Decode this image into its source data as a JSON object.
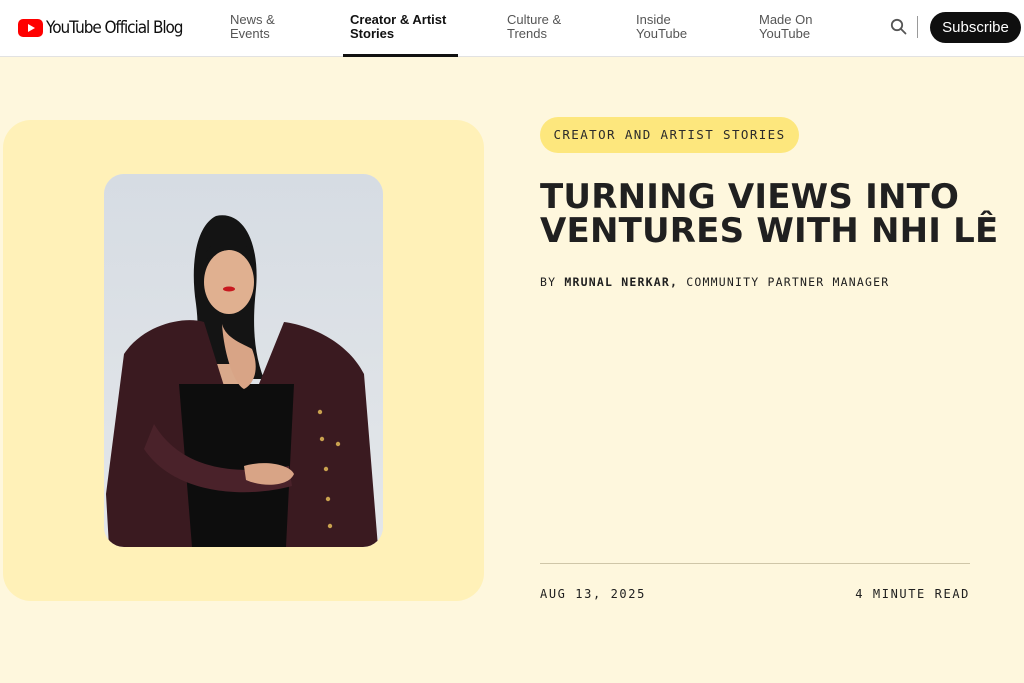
{
  "header": {
    "logo_text": "YouTube Official Blog",
    "nav": [
      {
        "line1": "News &",
        "line2": "Events"
      },
      {
        "line1": "Creator & Artist",
        "line2": "Stories"
      },
      {
        "line1": "Culture &",
        "line2": "Trends"
      },
      {
        "line1": "Inside",
        "line2": "YouTube"
      },
      {
        "line1": "Made On",
        "line2": "YouTube"
      }
    ],
    "active_nav": "Creator & Artist Stories",
    "subscribe_label": "Subscribe"
  },
  "article": {
    "category": "CREATOR AND ARTIST STORIES",
    "title_line1": "TURNING VIEWS INTO",
    "title_line2": "VENTURES WITH NHI LÊ",
    "by_prefix": "BY",
    "author": "MRUNAL NERKAR,",
    "author_role": "COMMUNITY PARTNER MANAGER",
    "date": "AUG 13, 2025",
    "read_time": "4 MINUTE READ"
  },
  "colors": {
    "page_bg": "#fef7dd",
    "card_bg": "#fff1b8",
    "badge_bg": "#fde77d",
    "brand_red": "#ff0000",
    "text_dark": "#202020"
  },
  "icons": {
    "logo": "youtube-play-icon",
    "search": "search-icon"
  }
}
